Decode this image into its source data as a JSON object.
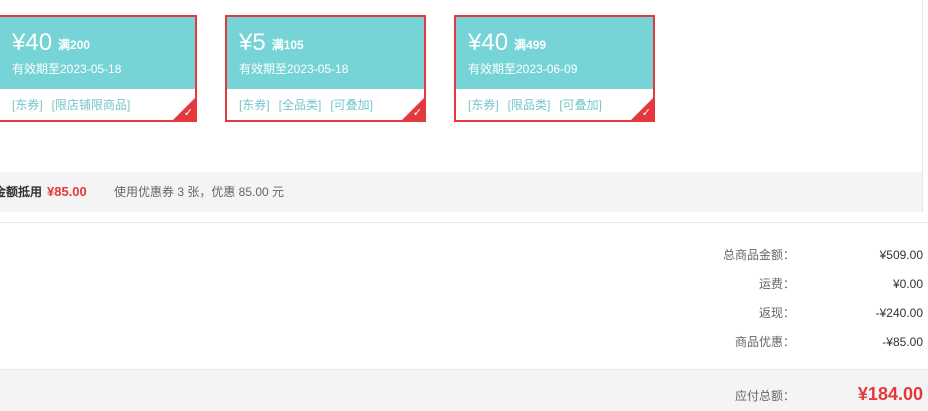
{
  "coupons": [
    {
      "amount": "¥40",
      "condition": "满200",
      "expiry": "有效期至2023-05-18",
      "tags": [
        "[东券]",
        "[限店铺限商品]"
      ]
    },
    {
      "amount": "¥5",
      "condition": "满105",
      "expiry": "有效期至2023-05-18",
      "tags": [
        "[东券]",
        "[全品类]",
        "[可叠加]"
      ]
    },
    {
      "amount": "¥40",
      "condition": "满499",
      "expiry": "有效期至2023-06-09",
      "tags": [
        "[东券]",
        "[限品类]",
        "[可叠加]"
      ]
    }
  ],
  "coupon_summary": {
    "label": "金额抵用",
    "amount": "¥85.00",
    "description": "使用优惠券 3 张，优惠 85.00 元"
  },
  "price_details": [
    {
      "label": "总商品金额：",
      "value": "¥509.00"
    },
    {
      "label": "运费：",
      "value": "¥0.00"
    },
    {
      "label": "返现：",
      "value": "-¥240.00"
    },
    {
      "label": "商品优惠：",
      "value": "-¥85.00"
    }
  ],
  "total": {
    "label": "应付总额：",
    "value": "¥184.00"
  },
  "colors": {
    "accent": "#e4393c",
    "coupon_bg": "#76d3d6",
    "tag_text": "#76c5c9"
  }
}
